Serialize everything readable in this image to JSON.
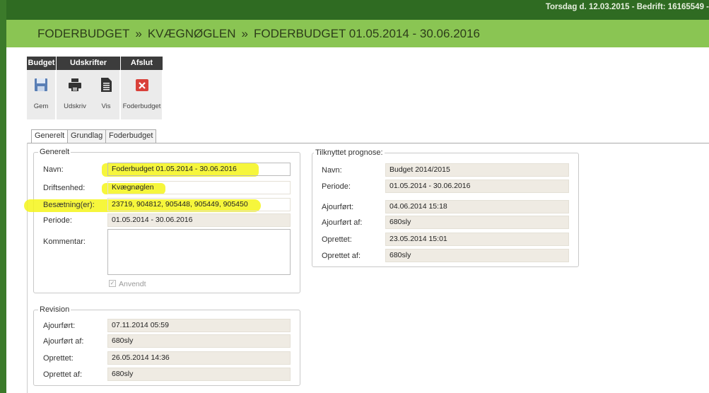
{
  "header": {
    "info": "Torsdag d. 12.03.2015 - Bedrift: 16165549 -"
  },
  "breadcrumb": {
    "item1": "FODERBUDGET",
    "item2": "KVÆGNØGLEN",
    "item3": "FODERBUDGET 01.05.2014 - 30.06.2016",
    "separator": "»"
  },
  "toolbar": {
    "group_budget": "Budget",
    "group_udskrifter": "Udskrifter",
    "group_afslut": "Afslut",
    "gem": "Gem",
    "udskriv": "Udskriv",
    "vis": "Vis",
    "foderbudget": "Foderbudget"
  },
  "tabs": {
    "generelt": "Generelt",
    "grundlag": "Grundlag",
    "foderbudget": "Foderbudget"
  },
  "generelt": {
    "legend": "Generelt",
    "navn_label": "Navn:",
    "navn_value": "Foderbudget 01.05.2014 - 30.06.2016",
    "drift_label": "Driftsenhed:",
    "drift_value": "Kvægnøglen",
    "bes_label": "Besætning(er):",
    "bes_value": "23719, 904812, 905448, 905449, 905450",
    "periode_label": "Periode:",
    "periode_value": "01.05.2014 - 30.06.2016",
    "kommentar_label": "Kommentar:",
    "anvendt_label": "Anvendt"
  },
  "revision": {
    "legend": "Revision",
    "ajour_label": "Ajourført:",
    "ajour_value": "07.11.2014 05:59",
    "ajour_af_label": "Ajourført af:",
    "ajour_af_value": "680sly",
    "opret_label": "Oprettet:",
    "opret_value": "26.05.2014 14:36",
    "opret_af_label": "Oprettet af:",
    "opret_af_value": "680sly"
  },
  "prognose": {
    "legend": "Tilknyttet prognose:",
    "navn_label": "Navn:",
    "navn_value": "Budget 2014/2015",
    "periode_label": "Periode:",
    "periode_value": "01.05.2014 - 30.06.2016",
    "ajour_label": "Ajourført:",
    "ajour_value": "04.06.2014 15:18",
    "ajour_af_label": "Ajourført af:",
    "ajour_af_value": "680sly",
    "opret_label": "Oprettet:",
    "opret_value": "23.05.2014 15:01",
    "opret_af_label": "Oprettet af:",
    "opret_af_value": "680sly"
  },
  "colors": {
    "top_bar": "#2f6b22",
    "breadcrumb_bar": "#8ac553",
    "highlight": "#f5f51a",
    "toolbar_head": "#3c3c3c"
  }
}
